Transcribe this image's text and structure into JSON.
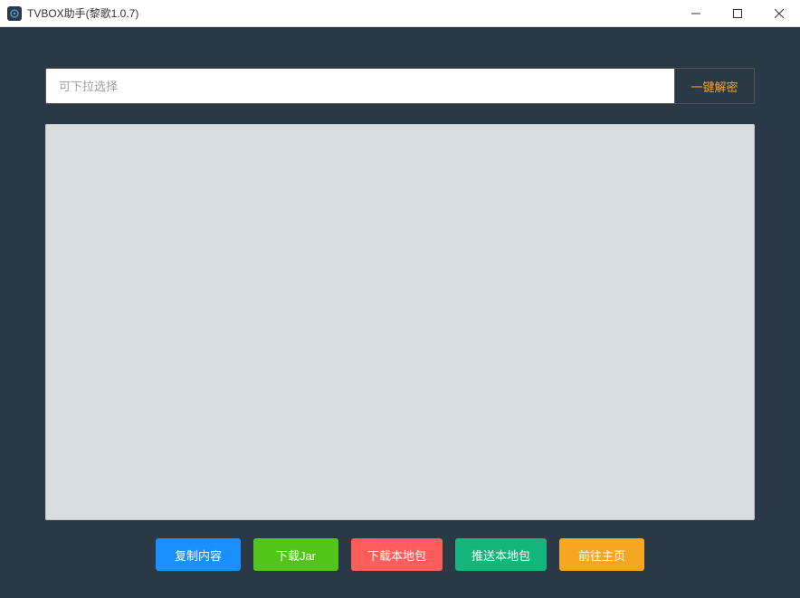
{
  "window": {
    "title": "TVBOX助手(黎歌1.0.7)"
  },
  "input": {
    "placeholder": "可下拉选择",
    "value": ""
  },
  "decrypt_button": "一键解密",
  "output": {
    "value": ""
  },
  "buttons": {
    "copy": "复制内容",
    "download_jar": "下载Jar",
    "download_local": "下载本地包",
    "push_local": "推送本地包",
    "go_home": "前往主页"
  }
}
